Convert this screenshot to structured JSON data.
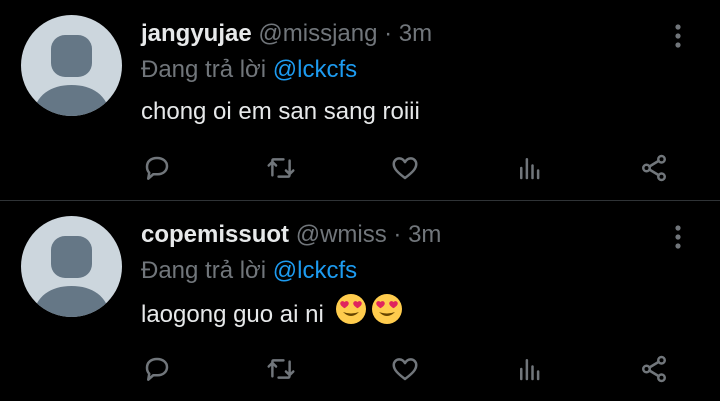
{
  "tweets": [
    {
      "username": "jangyujae",
      "handle": "@missjang",
      "separator": "·",
      "time": "3m",
      "reply_prefix": "Đang trả lời",
      "reply_mention": "@lckcfs",
      "text": "chong oi em san sang roiii",
      "emoji": []
    },
    {
      "username": "copemissuot",
      "handle": "@wmiss",
      "separator": "·",
      "time": "3m",
      "reply_prefix": "Đang trả lời",
      "reply_mention": "@lckcfs",
      "text": "laogong guo ai ni",
      "emoji": [
        "heart-eyes-emoji",
        "heart-eyes-emoji"
      ]
    }
  ],
  "icons": {
    "actions": [
      "reply-icon",
      "retweet-icon",
      "like-icon",
      "analytics-icon",
      "share-icon"
    ],
    "more": "more-vertical-icon",
    "avatar": "default-avatar-icon"
  },
  "colors": {
    "background": "#000000",
    "text_primary": "#e7e9ea",
    "text_secondary": "#71767b",
    "mention": "#1d9bf0",
    "divider": "#2f3336",
    "avatar_bg": "#ccd6dd",
    "avatar_fg": "#657786"
  }
}
